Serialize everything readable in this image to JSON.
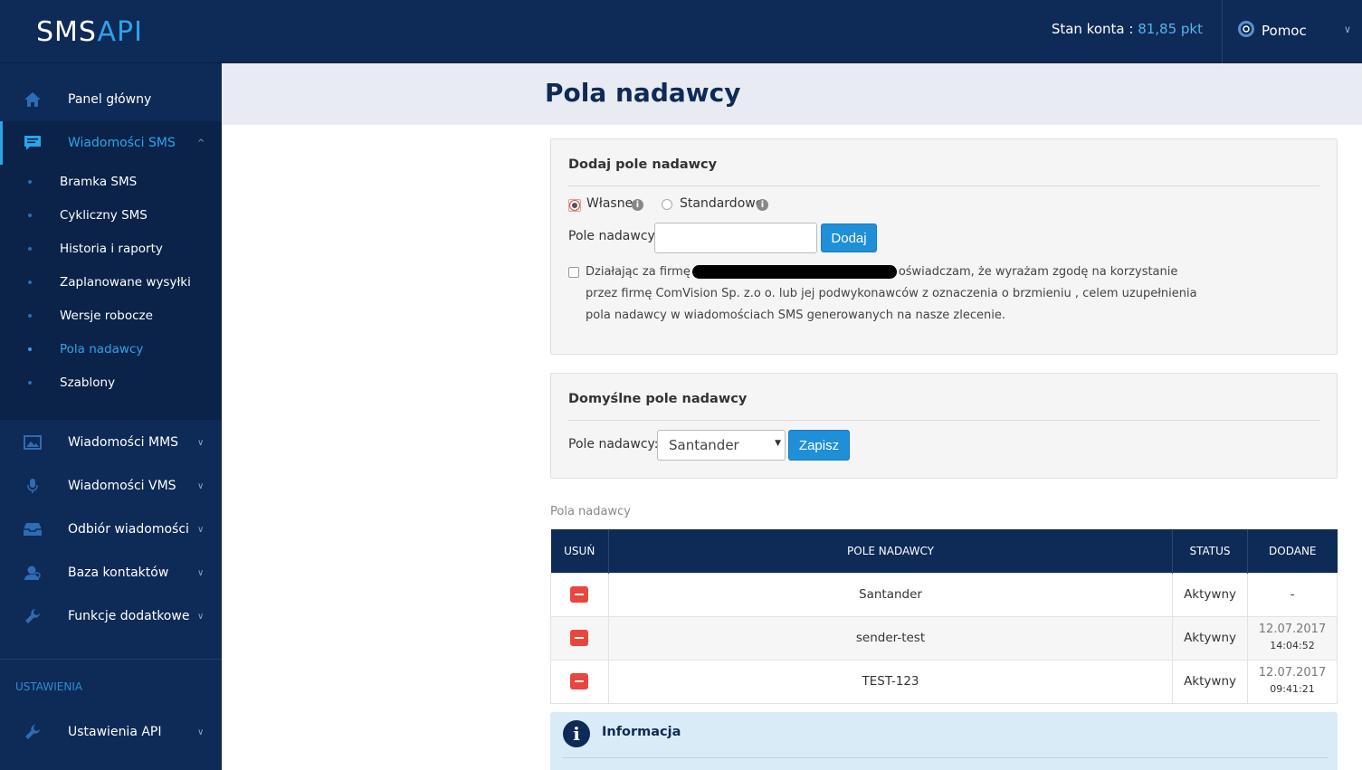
{
  "header": {
    "logo_prefix": "SMS",
    "logo_suffix": "API",
    "balance_label": "Stan konta : ",
    "balance_value": "81,85 pkt",
    "help_label": "Pomoc"
  },
  "sidebar": {
    "items": [
      {
        "label": "Panel główny",
        "icon": "home-icon"
      },
      {
        "label": "Wiadomości SMS",
        "icon": "message-icon"
      },
      {
        "label": "Wiadomości MMS",
        "icon": "image-icon"
      },
      {
        "label": "Wiadomości VMS",
        "icon": "microphone-icon"
      },
      {
        "label": "Odbiór wiadomości",
        "icon": "inbox-icon"
      },
      {
        "label": "Baza kontaktów",
        "icon": "contacts-icon"
      },
      {
        "label": "Funkcje dodatkowe",
        "icon": "wrench-icon"
      }
    ],
    "sms_submenu": [
      "Bramka SMS",
      "Cykliczny SMS",
      "Historia i raporty",
      "Zaplanowane wysyłki",
      "Wersje robocze",
      "Pola nadawcy",
      "Szablony"
    ],
    "settings_heading": "USTAWIENIA",
    "settings_items": [
      {
        "label": "Ustawienia API",
        "icon": "wrench-icon"
      }
    ]
  },
  "page": {
    "title": "Pola nadawcy"
  },
  "add_panel": {
    "title": "Dodaj pole nadawcy",
    "radio_own": "Własne",
    "radio_standard": "Standardowe",
    "field_label": "Pole nadawcy:",
    "field_value": "",
    "add_button": "Dodaj",
    "consent_part1": "Działając za firmę",
    "consent_part2": "oświadczam, że wyrażam zgodę na korzystanie",
    "consent_line2": "przez firmę ComVision Sp. z.o o. lub jej podwykonawców z oznaczenia o brzmieniu , celem uzupełnienia",
    "consent_line3": "pola nadawcy w wiadomościach SMS generowanych na nasze zlecenie."
  },
  "default_panel": {
    "title": "Domyślne pole nadawcy",
    "field_label": "Pole nadawcy:",
    "selected": "Santander",
    "save_button": "Zapisz"
  },
  "senders_section": {
    "caption": "Pola nadawcy",
    "columns": [
      "USUŃ",
      "POLE NADAWCY",
      "STATUS",
      "DODANE"
    ],
    "rows": [
      {
        "name": "Santander",
        "status": "Aktywny",
        "date": "-",
        "time": ""
      },
      {
        "name": "sender-test",
        "status": "Aktywny",
        "date": "12.07.2017",
        "time": "14:04:52"
      },
      {
        "name": "TEST-123",
        "status": "Aktywny",
        "date": "12.07.2017",
        "time": "09:41:21"
      }
    ]
  },
  "info_panel": {
    "title": "Informacja"
  },
  "colors": {
    "navy": "#0e2a56",
    "accent": "#2aa5e8",
    "button_blue": "#1f8fd8",
    "delete_red": "#e8463e"
  }
}
